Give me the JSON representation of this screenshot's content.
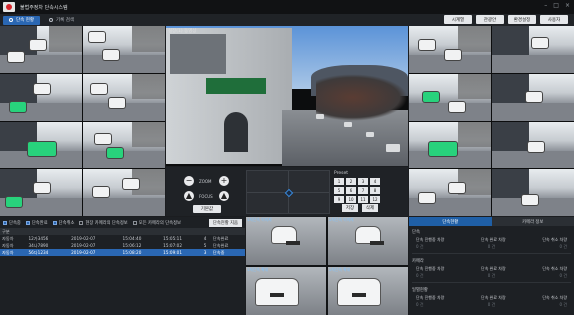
{
  "app": {
    "title": "불법주정차 단속시스템",
    "controls": [
      "–",
      "□",
      "×"
    ]
  },
  "topnav": {
    "tabs": [
      {
        "label": "단속 현황",
        "active": true
      },
      {
        "label": "기록 검색",
        "active": false
      }
    ],
    "buttons": [
      "시계열",
      "관광안",
      "환경설정",
      "사용자"
    ]
  },
  "main_video": {
    "label": "실장(1) 동영상"
  },
  "ptz": {
    "zoom_label": "ZOOM",
    "focus_label": "FOCUS",
    "apply_label": "기본값",
    "preset_title": "Preset",
    "presets": [
      "1",
      "2",
      "3",
      "4",
      "5",
      "6",
      "7",
      "8",
      "9",
      "10",
      "11",
      "12"
    ],
    "preset_actions": [
      "저장",
      "삭제"
    ]
  },
  "events": {
    "filters": [
      {
        "label": "단속중",
        "checked": true
      },
      {
        "label": "단속완료",
        "checked": true
      },
      {
        "label": "단속취소",
        "checked": true
      },
      {
        "label": "현장 카메라의 단속정보",
        "checked": false
      },
      {
        "label": "모든 카메라의 단속정보",
        "checked": false
      }
    ],
    "reset_label": "단속현황 지움",
    "columns": [
      "구분",
      "",
      "",
      "",
      "",
      "",
      ""
    ],
    "rows": [
      {
        "cells": [
          "자동차",
          "12가3456",
          "2019-02-07",
          "15:04:40",
          "15:05:11",
          "4",
          "단속완료"
        ],
        "selected": false
      },
      {
        "cells": [
          "자동차",
          "34나7890",
          "2019-02-07",
          "15:06:12",
          "15:07:02",
          "5",
          "단속완료"
        ],
        "selected": false
      },
      {
        "cells": [
          "자동차",
          "56다1234",
          "2019-02-07",
          "15:08:20",
          "15:09:01",
          "3",
          "단속중"
        ],
        "selected": true
      }
    ]
  },
  "snapshots": [
    {
      "label": "1차단속 이미지"
    },
    {
      "label": "2차단속 이미지"
    },
    {
      "label": "1차단속 확대"
    },
    {
      "label": "2차단속 확대"
    }
  ],
  "details": {
    "tabs": [
      {
        "label": "단속현황",
        "active": true
      },
      {
        "label": "카메라 정보",
        "active": false
      }
    ],
    "sections": [
      {
        "title": "단속",
        "row": [
          "단속 진행중 차량",
          "단속 완료 차량",
          "단속 취소 차량"
        ],
        "vals": [
          "0 건",
          "0 건",
          "0 건"
        ]
      },
      {
        "title": "카메라",
        "row": [
          "단속 진행중 차량",
          "단속 완료 차량",
          "단속 취소 차량"
        ],
        "vals": [
          "0 건",
          "0 건",
          "0 건"
        ]
      },
      {
        "title": "일별현황",
        "row": [
          "단속 진행중 차량",
          "단속 완료 차량",
          "단속 취소 차량"
        ],
        "vals": [
          "0 건",
          "0 건",
          "0 건"
        ]
      }
    ]
  }
}
